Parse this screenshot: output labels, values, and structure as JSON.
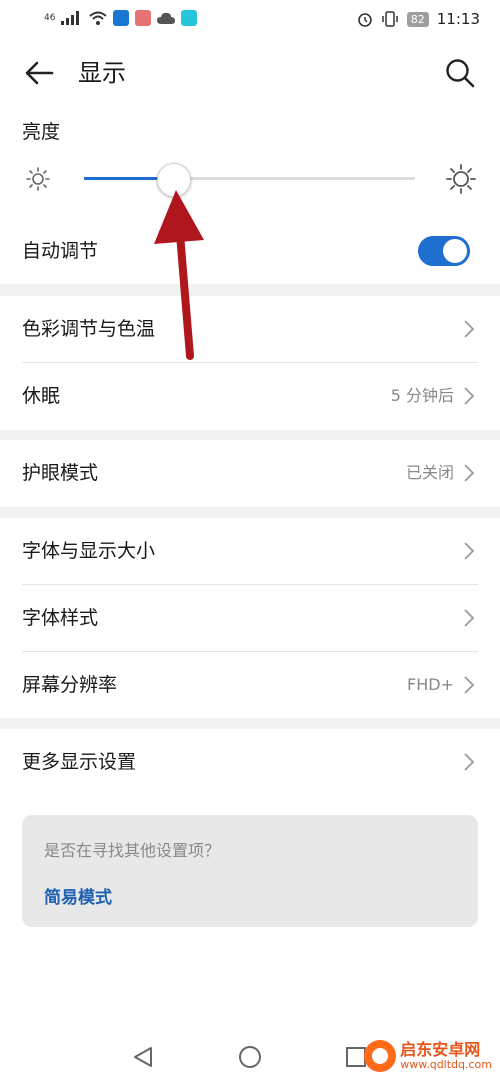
{
  "status": {
    "signal": "46",
    "battery": "82",
    "time": "11:13"
  },
  "header": {
    "title": "显示"
  },
  "brightness": {
    "label": "亮度",
    "level": 0.27,
    "auto_label": "自动调节",
    "auto_on": true
  },
  "group1": {
    "color_temp": {
      "label": "色彩调节与色温"
    },
    "sleep": {
      "label": "休眠",
      "value": "5 分钟后"
    }
  },
  "group2": {
    "eye_mode": {
      "label": "护眼模式",
      "value": "已关闭"
    }
  },
  "group3": {
    "font_display_size": {
      "label": "字体与显示大小"
    },
    "font_style": {
      "label": "字体样式"
    },
    "resolution": {
      "label": "屏幕分辨率",
      "value": "FHD+"
    }
  },
  "group4": {
    "more": {
      "label": "更多显示设置"
    }
  },
  "suggest": {
    "question": "是否在寻找其他设置项？",
    "link": "简易模式"
  },
  "watermark": {
    "title": "启东安卓网",
    "url": "www.qdltdq.com"
  },
  "colors": {
    "accent": "#1e6fd0",
    "link": "#1e5fb0",
    "annotation_arrow": "#b0161e"
  }
}
